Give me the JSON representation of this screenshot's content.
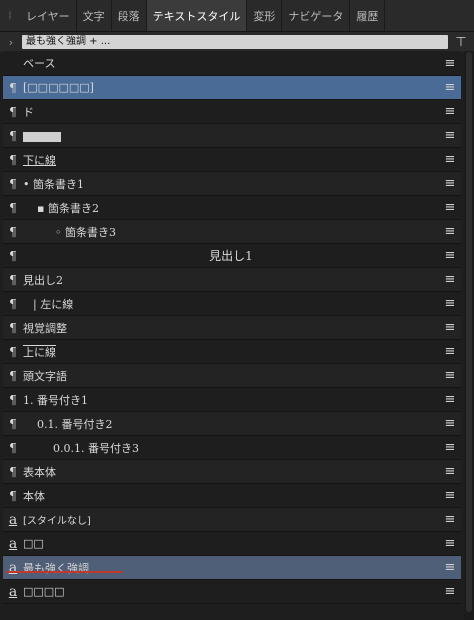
{
  "tabs": [
    "レイヤー",
    "文字",
    "段落",
    "テキストスタイル",
    "変形",
    "ナビゲータ",
    "履歴"
  ],
  "active_tab": "テキストスタイル",
  "current_style": "最も強く強調 + ...",
  "rows": [
    {
      "glyph": "",
      "label": "ベース"
    },
    {
      "glyph": "¶",
      "label": "[□□□□□□]"
    },
    {
      "glyph": "¶",
      "label": "ド"
    },
    {
      "glyph": "¶",
      "label": "□□□"
    },
    {
      "glyph": "¶",
      "label": "下に線"
    },
    {
      "glyph": "¶",
      "label": "•   箇条書き1"
    },
    {
      "glyph": "¶",
      "label": "▪   箇条書き2"
    },
    {
      "glyph": "¶",
      "label": "◦   箇条書き3"
    },
    {
      "glyph": "¶",
      "label": "見出し1"
    },
    {
      "glyph": "¶",
      "label": "見出し2"
    },
    {
      "glyph": "¶",
      "label": "|   左に線"
    },
    {
      "glyph": "¶",
      "label": "視覚調整"
    },
    {
      "glyph": "¶",
      "label": "上に線"
    },
    {
      "glyph": "¶",
      "label": "頭文字語"
    },
    {
      "glyph": "¶",
      "label": "1.   番号付き1"
    },
    {
      "glyph": "¶",
      "label": "0.1.   番号付き2"
    },
    {
      "glyph": "¶",
      "label": "0.0.1.   番号付き3"
    },
    {
      "glyph": "¶",
      "label": "表本体"
    },
    {
      "glyph": "¶",
      "label": "本体"
    },
    {
      "glyph": "a",
      "label": "[スタイルなし]"
    },
    {
      "glyph": "a",
      "label": "□□"
    },
    {
      "glyph": "a",
      "label": "最も強く強調"
    },
    {
      "glyph": "a",
      "label": "□□□□"
    }
  ],
  "icons": {
    "grip": "grip-icon",
    "chevron": "chevron-right-icon",
    "new_style": "new-text-style-icon",
    "row_menu": "hamburger-menu-icon"
  },
  "colors": {
    "selected_row": "#4a6b95",
    "underline_accent": "#c0392b"
  }
}
